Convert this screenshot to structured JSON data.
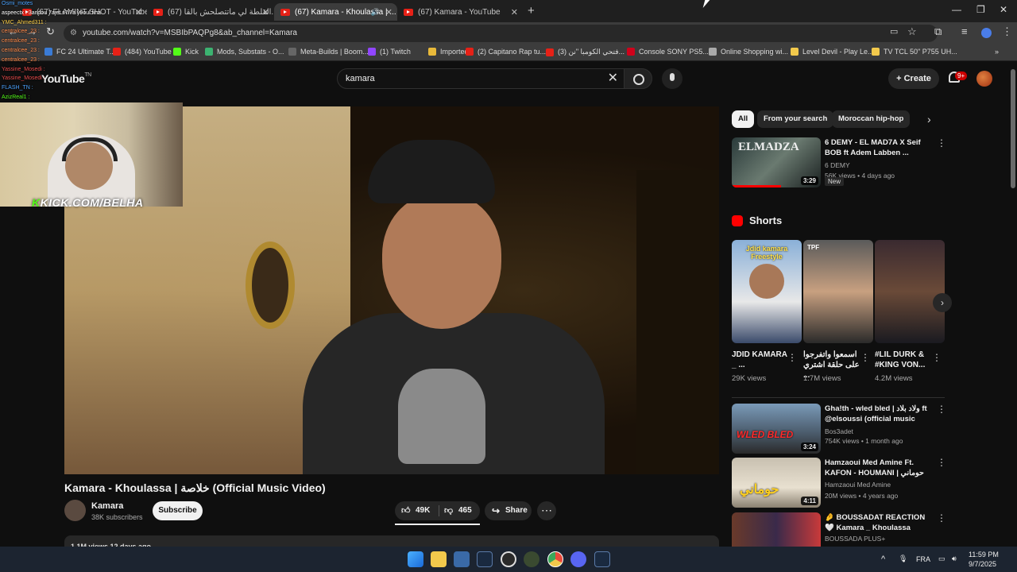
{
  "browser": {
    "tabs": [
      {
        "label": "(67) FLAMINT SHOT - YouTube"
      },
      {
        "label": "(67) القلطة لي ماتتصلحش بالقا..."
      },
      {
        "label": "(67) Kamara - Khoulassa | ..."
      },
      {
        "label": "(67) Kamara - YouTube"
      }
    ],
    "url": "youtube.com/watch?v=MSBIbPAQPg8&ab_channel=Kamara",
    "bookmarks": [
      {
        "label": "FC 24 Ultimate T...",
        "color": "#3a7bd5"
      },
      {
        "label": "(484) YouTube",
        "color": "#e62117"
      },
      {
        "label": "Kick",
        "color": "#53fc18"
      },
      {
        "label": "Mods, Substats - O...",
        "color": "#3cb371"
      },
      {
        "label": "Meta-Builds | Boom...",
        "color": "#666666"
      },
      {
        "label": "(1) Twitch",
        "color": "#9146ff"
      },
      {
        "label": "Imported",
        "color": "#e8b93a"
      },
      {
        "label": "(2) Capitano Rap tu...",
        "color": "#e62117"
      },
      {
        "label": "(3) فتحي الكومبا \"نن...",
        "color": "#e62117"
      },
      {
        "label": "Console SONY PS5...",
        "color": "#d0021b"
      },
      {
        "label": "Online Shopping wi...",
        "color": "#aaaaaa"
      },
      {
        "label": "Level Devil - Play Le...",
        "color": "#f2c94c"
      },
      {
        "label": "TV TCL 50\" P755 UH...",
        "color": "#f2c94c"
      }
    ]
  },
  "youtube": {
    "logo": "YouTube",
    "logo_tm": "TN",
    "search_value": "kamara",
    "create_label": "Create",
    "notif_count": "9+"
  },
  "stream_overlay": {
    "kick_prefix": "K",
    "kick_text": "KICK.COM/BELHA",
    "chat": [
      {
        "user": "Osmi_motes",
        "color": "#4aa3ff"
      },
      {
        "user": "aspeectx : 3andou 7ajet s7i7a y9oul fiha",
        "color": "#ffffff"
      },
      {
        "user": "YMC_Ahmed311 :",
        "color": "#ffd24a"
      },
      {
        "user": "centralcee_23 :",
        "color": "#ff8a4a"
      },
      {
        "user": "centralcee_23 :",
        "color": "#ff8a4a"
      },
      {
        "user": "centralcee_23 :",
        "color": "#ff8a4a"
      },
      {
        "user": "centralcee_23 :",
        "color": "#ff8a4a"
      },
      {
        "user": "Yassine_Mosedi :",
        "color": "#e84a4a"
      },
      {
        "user": "Yassine_Mosedi :",
        "color": "#e84a4a"
      },
      {
        "user": "FLASH_TN :",
        "color": "#4aa3ff"
      },
      {
        "user": "AzizReal1 :",
        "color": "#53fc18"
      }
    ]
  },
  "video": {
    "title": "Kamara - Khoulassa | خلاصة (Official Music Video)",
    "channel": "Kamara",
    "subscribers": "38K subscribers",
    "subscribe_label": "Subscribe",
    "likes": "49K",
    "dislikes": "465",
    "share_label": "Share",
    "desc_meta": "1.1M views  12 days ago"
  },
  "sidebar": {
    "chips": [
      "All",
      "From your search",
      "Moroccan hip-hop"
    ],
    "top_rec": {
      "title": "6 DEMY - EL MAD7A X Seif BOB ft Adem Labben ...",
      "channel": "6 DEMY",
      "meta": "56K views • 4 days ago",
      "duration": "3:29",
      "badge": "New",
      "thumb_text": "ELMADZA"
    },
    "shorts_heading": "Shorts",
    "shorts": [
      {
        "title": "JDID KAMARA _ ...",
        "views": "29K views",
        "thumb_text": "Jdid kamara Freestyle"
      },
      {
        "title": "اسمعوا واتفرجوا على حلقة اشتري ...",
        "views": "1.7M views",
        "thumb_text": "TPF"
      },
      {
        "title": "#LIL DURK & #KING VON...",
        "views": "4.2M views",
        "thumb_text": ""
      }
    ],
    "recs": [
      {
        "title": "Gha!th - wled bled | ولاد بلاد ft @elsoussi (official music vid...",
        "channel": "Bos3adet",
        "meta": "754K views • 1 month ago",
        "duration": "3:24",
        "thumb_text": "WLED BLED"
      },
      {
        "title": "Hamzaoui Med Amine Ft. KAFON - HOUMANI | حوماني (...",
        "channel": "Hamzaoui Med Amine",
        "meta": "20M views • 4 years ago",
        "duration": "4:11",
        "thumb_text": "حوماني"
      },
      {
        "title": "🤌 BOUSSADAT REACTION 🤍 Kamara _ Khoulassa",
        "channel": "BOUSSADA PLUS+",
        "meta": "",
        "duration": "",
        "thumb_text": ""
      }
    ]
  },
  "taskbar": {
    "lang": "FRA",
    "time": "11:59 PM",
    "date": "9/7/2025"
  }
}
